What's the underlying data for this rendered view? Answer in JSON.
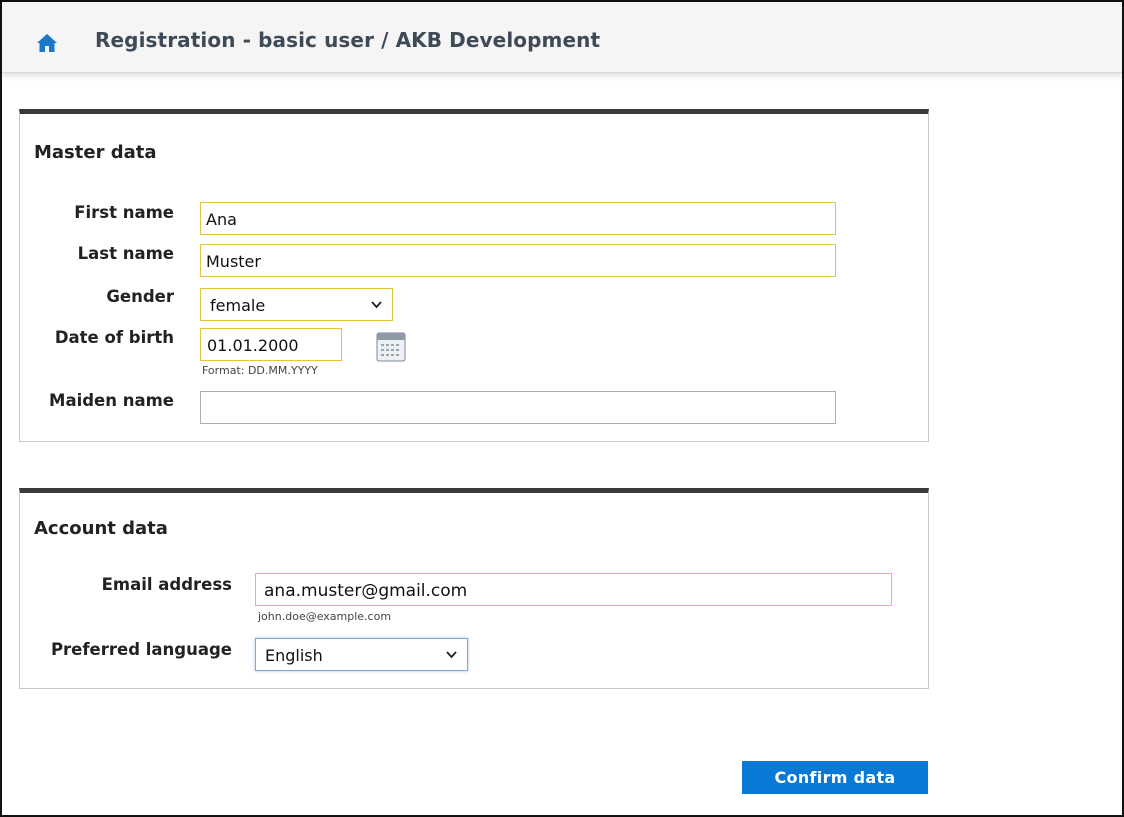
{
  "header": {
    "title": "Registration - basic user  / AKB Development",
    "icon": "home-icon"
  },
  "master_data": {
    "title": "Master data",
    "first_name": {
      "label": "First name",
      "value": "Ana"
    },
    "last_name": {
      "label": "Last name",
      "value": "Muster"
    },
    "gender": {
      "label": "Gender",
      "value": "female"
    },
    "date_of_birth": {
      "label": "Date of birth",
      "value": "01.01.2000",
      "hint": "Format: DD.MM.YYYY"
    },
    "maiden_name": {
      "label": "Maiden name",
      "value": ""
    }
  },
  "account_data": {
    "title": "Account data",
    "email": {
      "label": "Email address",
      "value": "ana.muster@gmail.com",
      "hint": "john.doe@example.com"
    },
    "language": {
      "label": "Preferred language",
      "value": "English"
    }
  },
  "actions": {
    "confirm_label": "Confirm data"
  },
  "colors": {
    "accent": "#0a79d6",
    "field_border": "#e3c43a",
    "header_text": "#3f4a57"
  }
}
